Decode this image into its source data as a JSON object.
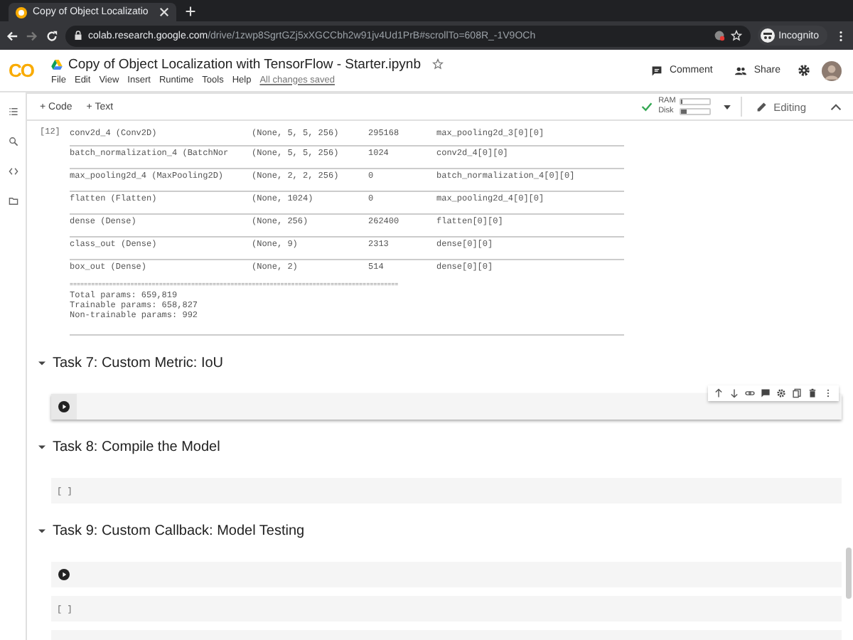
{
  "browser": {
    "tab_title": "Copy of Object Localizatio",
    "url_host": "colab.research.google.com",
    "url_path": "/drive/1zwp8SgrtGZj5xXGCCbh2w91jv4Ud1PrB#scrollTo=608R_-1V9OCh",
    "profile": "Incognito"
  },
  "notebook": {
    "logo": "CO",
    "title": "Copy of Object Localization with TensorFlow - Starter.ipynb",
    "menus": [
      "File",
      "Edit",
      "View",
      "Insert",
      "Runtime",
      "Tools",
      "Help"
    ],
    "save_status": "All changes saved",
    "actions": [
      "Comment",
      "Share"
    ]
  },
  "toolbar": {
    "add_buttons": [
      "+ Code",
      "+ Text"
    ],
    "resources": [
      {
        "label": "RAM",
        "level": 0.05
      },
      {
        "label": "Disk",
        "level": 0.2
      }
    ],
    "mode": "Editing"
  },
  "output": {
    "prompt": "[12]",
    "rows": [
      [
        "conv2d_4 (Conv2D)",
        "(None, 5, 5, 256)",
        "295168",
        "max_pooling2d_3[0][0]"
      ],
      [
        "batch_normalization_4 (BatchNor",
        "(None, 5, 5, 256)",
        "1024",
        "conv2d_4[0][0]"
      ],
      [
        "max_pooling2d_4 (MaxPooling2D)",
        "(None, 2, 2, 256)",
        "0",
        "batch_normalization_4[0][0]"
      ],
      [
        "flatten (Flatten)",
        "(None, 1024)",
        "0",
        "max_pooling2d_4[0][0]"
      ],
      [
        "dense (Dense)",
        "(None, 256)",
        "262400",
        "flatten[0][0]"
      ],
      [
        "class_out (Dense)",
        "(None, 9)",
        "2313",
        "dense[0][0]"
      ],
      [
        "box_out (Dense)",
        "(None, 2)",
        "514",
        "dense[0][0]"
      ]
    ],
    "rule": "============================================================================================",
    "summary": [
      "Total params: 659,819",
      "Trainable params: 658,827",
      "Non-trainable params: 992"
    ]
  },
  "sections": [
    {
      "title": "Task 7: Custom Metric: IoU",
      "expanded": true,
      "cells": [
        {
          "kind": "run",
          "selected": true
        }
      ]
    },
    {
      "title": "Task 8: Compile the Model",
      "expanded": true,
      "cells": [
        {
          "kind": "prompt",
          "prompt": "[ ]",
          "selected": false
        }
      ]
    },
    {
      "title": "Task 9: Custom Callback: Model Testing",
      "expanded": true,
      "cells": [
        {
          "kind": "run",
          "selected": false
        },
        {
          "kind": "prompt",
          "prompt": "[ ]",
          "selected": false
        },
        {
          "kind": "blank",
          "selected": false
        }
      ]
    }
  ]
}
